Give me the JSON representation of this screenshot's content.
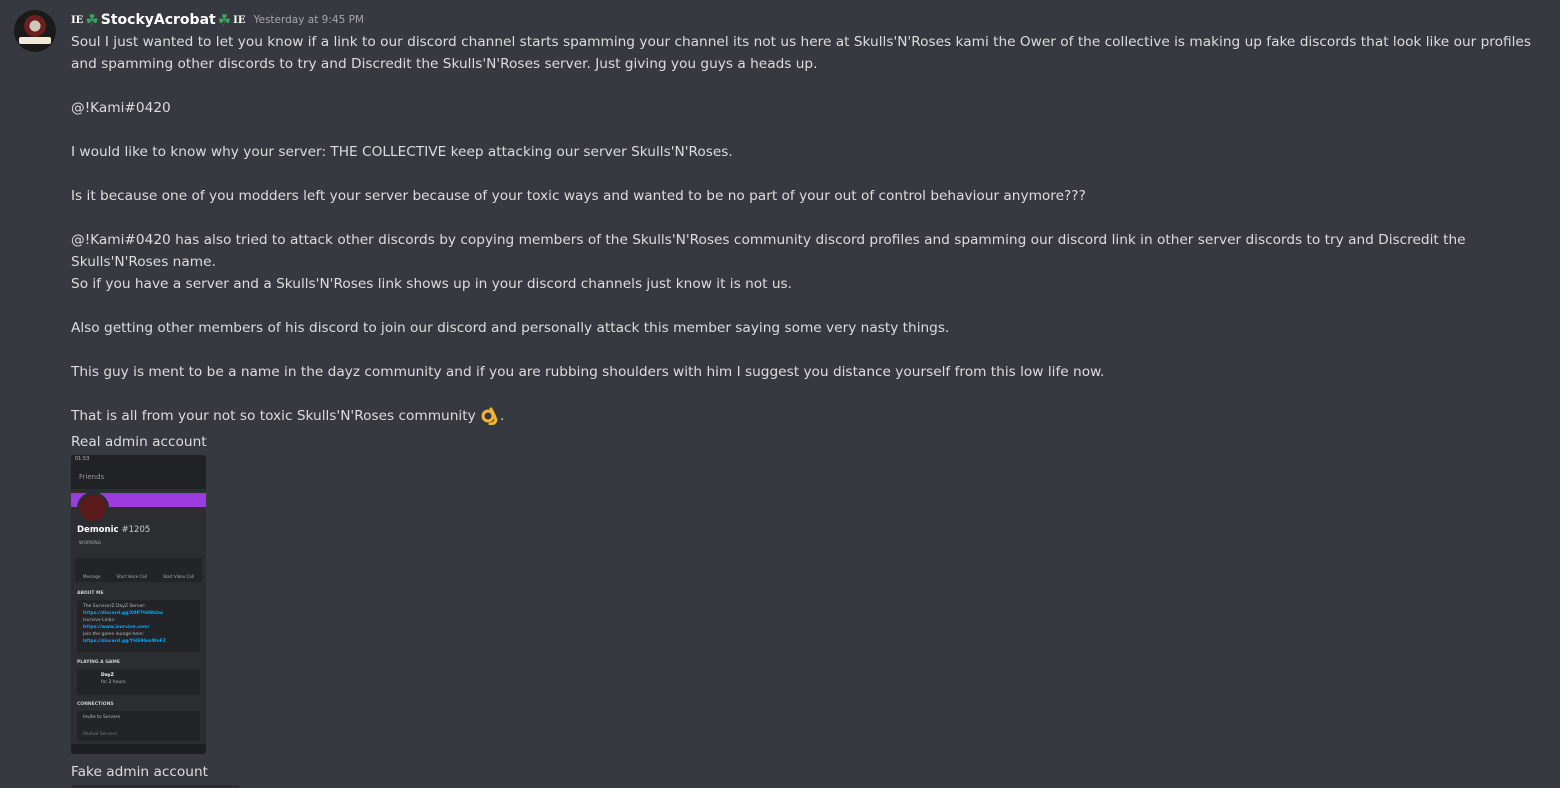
{
  "message": {
    "username": "StockyAcrobat",
    "tag_prefix": "IE",
    "tag_suffix": "IE",
    "clover_icon": "☘",
    "timestamp": "Yesterday at 9:45 PM",
    "paragraphs": [
      "Soul I just wanted to let you know if a link to our discord channel starts spamming your channel its not us here at Skulls'N'Roses kami the Ower of the collective is making up fake discords that look like our profiles and spamming other discords to try and Discredit the Skulls'N'Roses server. Just giving you guys a heads up.",
      "@!Kami#0420",
      "I would like to know why your server: THE COLLECTIVE keep attacking our server Skulls'N'Roses.",
      "Is it because one of you modders left your server because of your toxic ways and wanted to be no part of your out of control behaviour anymore???",
      "@!Kami#0420 has also tried to attack other discords by copying members of the Skulls'N'Roses community discord profiles and spamming our discord link in other server discords to try and Discredit the Skulls'N'Roses name.",
      "So if you have a server and a Skulls'N'Roses link shows up in your discord channels just know it is not us.",
      "Also getting other members of his discord to join our discord and personally attack this member saying some very nasty things.",
      "This guy is ment to be a name in the dayz community and if you are rubbing shoulders with him I suggest you distance yourself from this low life now.",
      "That is all from your not so toxic Skulls'N'Roses community"
    ],
    "after_emoji": ".",
    "label_real": "Real admin account",
    "label_fake": "Fake admin account"
  },
  "screenshot": {
    "time": "01:53",
    "friends": "Friends",
    "profile_name": "Demonic",
    "profile_tag": "#1205",
    "profile_status": "WORKING",
    "actions": [
      "Message",
      "Start Voice Call",
      "Start Video Call"
    ],
    "about_heading": "ABOUT ME",
    "about_lines": [
      "The SurvivorZ DayZ Server:",
      "https://discord.gg/X9P7t6NhGw",
      "Isurvive Links:",
      "https://www.isurvive.com/",
      "Join the game lounge here:",
      "https://discord.gg/YHS9GmWoFZ"
    ],
    "playing_heading": "PLAYING A GAME",
    "game_name": "DayZ",
    "game_time": "for 2 hours",
    "connections_heading": "CONNECTIONS",
    "invite": "Invite to Servers",
    "mutual": "Mutual Servers"
  },
  "colors": {
    "background": "#36393f",
    "username": "#ffffff",
    "clover": "#3ba55d",
    "timestamp": "#a3a6aa",
    "text": "#dcddde",
    "banner": "#9b3be0"
  }
}
